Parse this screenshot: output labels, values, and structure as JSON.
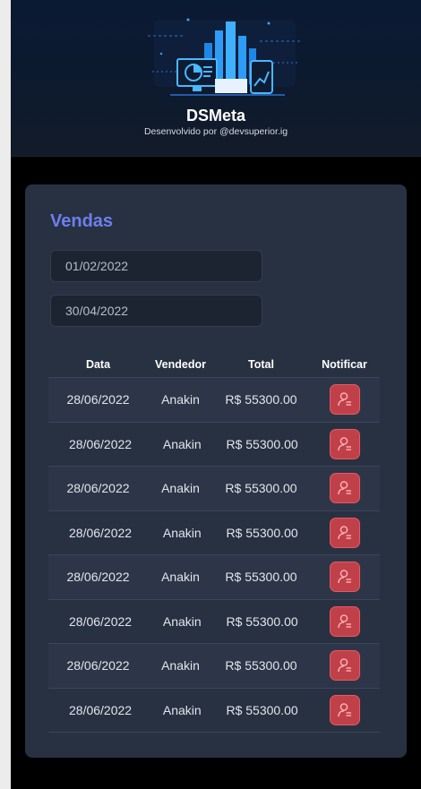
{
  "header": {
    "title": "DSMeta",
    "subtitle": "Desenvolvido por @devsuperior.ig"
  },
  "card": {
    "title": "Vendas",
    "min_date": "01/02/2022",
    "max_date": "30/04/2022"
  },
  "table": {
    "columns": [
      "Data",
      "Vendedor",
      "Total",
      "Notificar"
    ],
    "rows": [
      {
        "date": "28/06/2022",
        "seller": "Anakin",
        "total": "R$ 55300.00"
      },
      {
        "date": "28/06/2022",
        "seller": "Anakin",
        "total": "R$ 55300.00"
      },
      {
        "date": "28/06/2022",
        "seller": "Anakin",
        "total": "R$ 55300.00"
      },
      {
        "date": "28/06/2022",
        "seller": "Anakin",
        "total": "R$ 55300.00"
      },
      {
        "date": "28/06/2022",
        "seller": "Anakin",
        "total": "R$ 55300.00"
      },
      {
        "date": "28/06/2022",
        "seller": "Anakin",
        "total": "R$ 55300.00"
      },
      {
        "date": "28/06/2022",
        "seller": "Anakin",
        "total": "R$ 55300.00"
      },
      {
        "date": "28/06/2022",
        "seller": "Anakin",
        "total": "R$ 55300.00"
      }
    ]
  },
  "colors": {
    "accent": "#6c7ff0",
    "card": "#283142",
    "notify": "#e65a60"
  },
  "icons": {
    "logo": "dashboard-illustration",
    "notify": "user-notify-icon"
  }
}
